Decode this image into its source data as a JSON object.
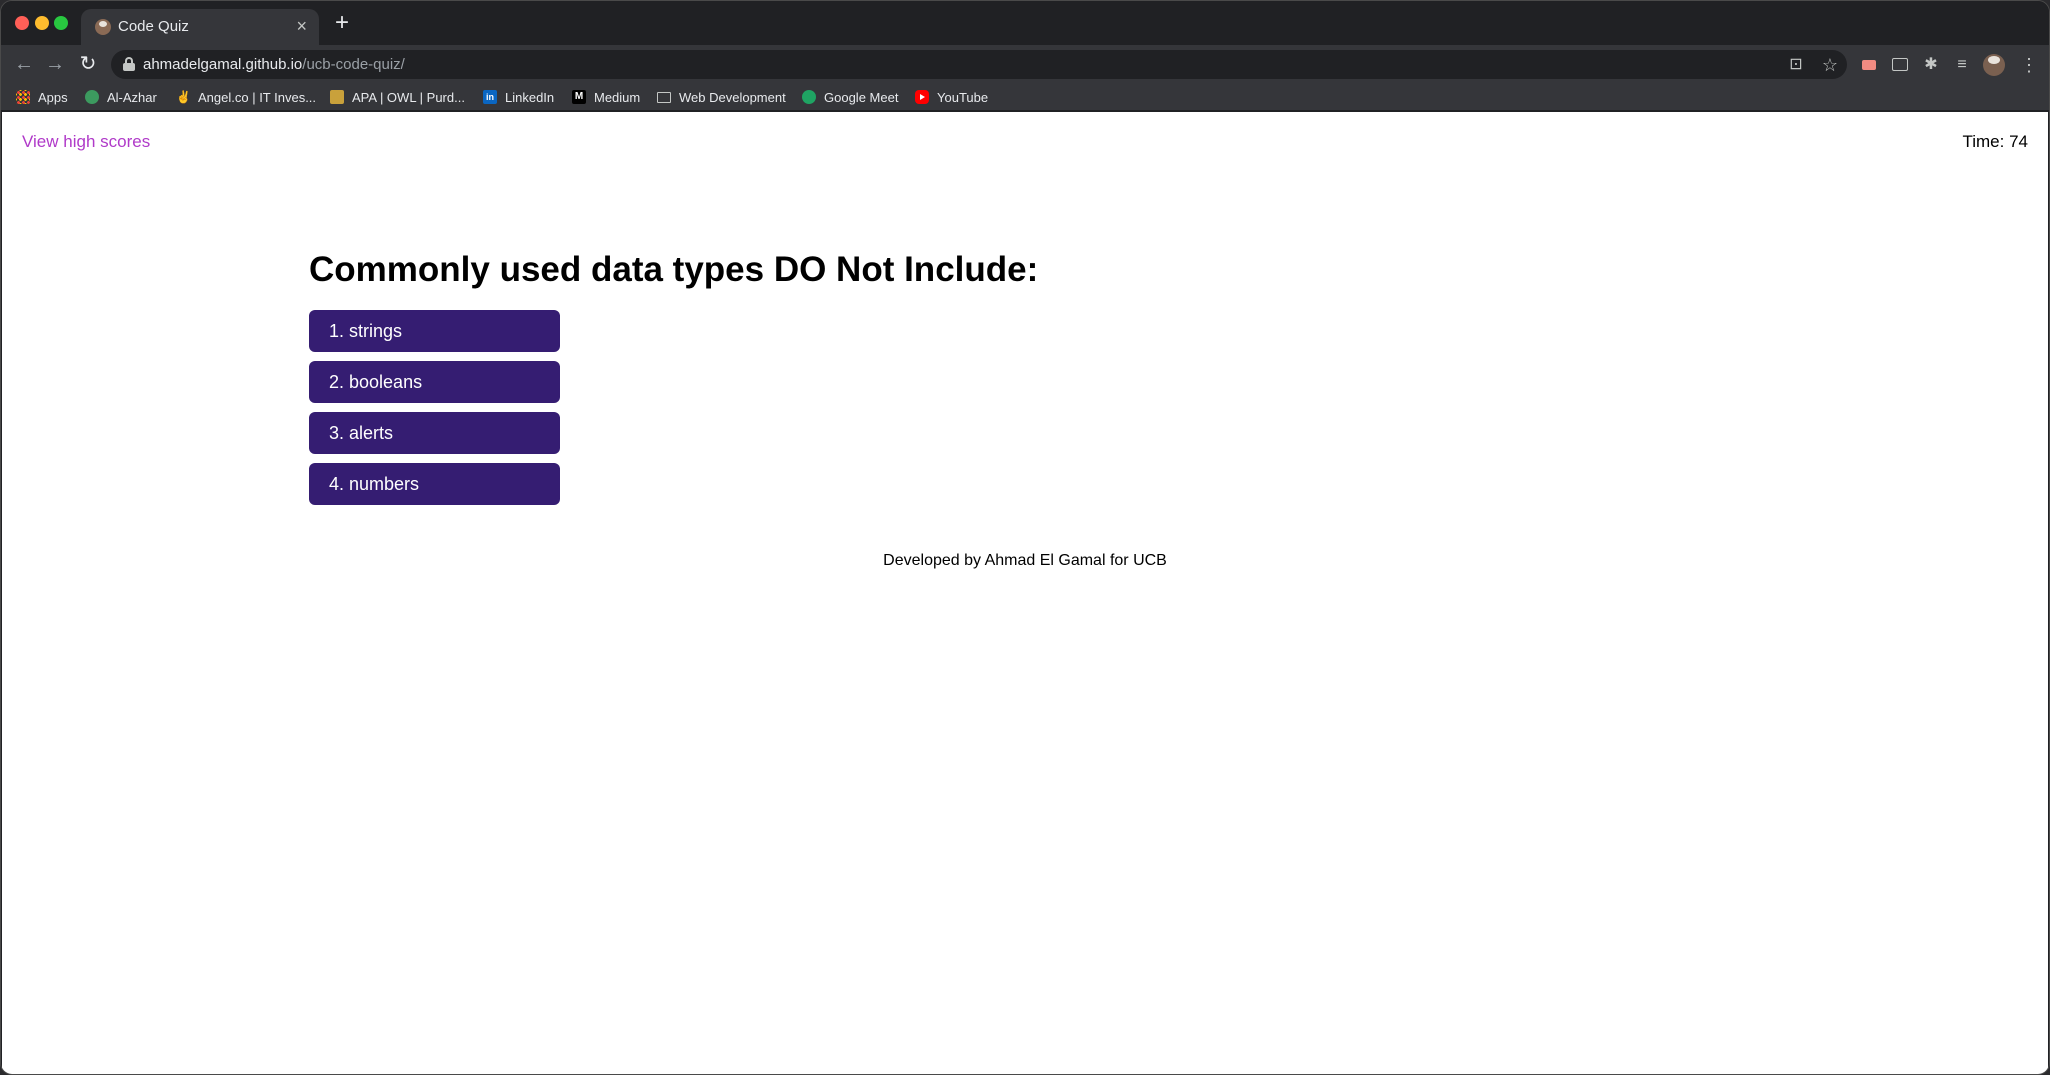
{
  "browser": {
    "tab_title": "Code Quiz",
    "url_domain": "ahmadelgamal.github.io",
    "url_path": "/ucb-code-quiz/",
    "bookmarks": [
      {
        "label": "Apps",
        "icon": "apps-grid-icon"
      },
      {
        "label": "Al-Azhar",
        "icon": "al-azhar-icon"
      },
      {
        "label": "Angel.co | IT Inves...",
        "icon": "angel-icon"
      },
      {
        "label": "APA | OWL | Purd...",
        "icon": "owl-icon"
      },
      {
        "label": "LinkedIn",
        "icon": "linkedin-icon"
      },
      {
        "label": "Medium",
        "icon": "medium-icon"
      },
      {
        "label": "Web Development",
        "icon": "folder-icon"
      },
      {
        "label": "Google Meet",
        "icon": "google-meet-icon"
      },
      {
        "label": "YouTube",
        "icon": "youtube-icon"
      }
    ]
  },
  "page": {
    "high_scores_link": "View high scores",
    "timer_label": "Time:",
    "timer_value": "74",
    "question": "Commonly used data types DO Not Include:",
    "choices": [
      "1. strings",
      "2. booleans",
      "3. alerts",
      "4. numbers"
    ],
    "footer": "Developed by Ahmad El Gamal for UCB"
  },
  "colors": {
    "choice_button": "#351d72",
    "link": "#b03ac9"
  }
}
